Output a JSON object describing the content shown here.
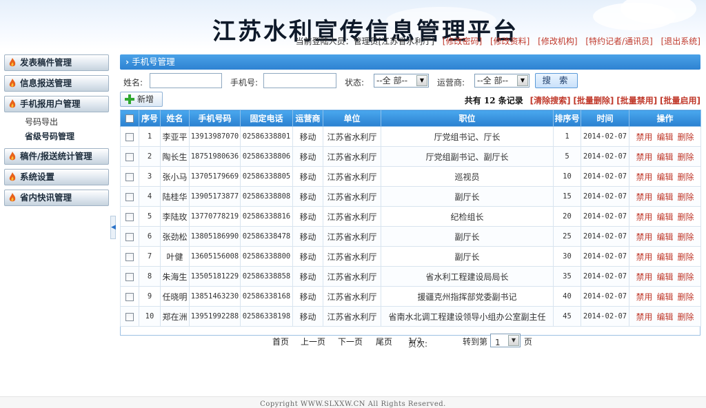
{
  "header": {
    "title": "江苏水利宣传信息管理平台",
    "current_user_label": "当前登陆人员：管理员[江苏省水利厅]",
    "links": [
      "[修改密码]",
      "[修改资料]",
      "[修改机构]",
      "[特约记者/通讯员]",
      "[退出系统]"
    ]
  },
  "sidebar": {
    "items": [
      {
        "label": "发表稿件管理"
      },
      {
        "label": "信息报送管理"
      },
      {
        "label": "手机报用户管理"
      },
      {
        "label": "稿件/报送统计管理"
      },
      {
        "label": "系统设置"
      },
      {
        "label": "省内快讯管理"
      }
    ],
    "sub_items": [
      "号码导出",
      "省级号码管理"
    ]
  },
  "panel": {
    "title": "手机号管理"
  },
  "search": {
    "name_label": "姓名:",
    "phone_label": "手机号:",
    "status_label": "状态:",
    "status_value": "--全 部--",
    "carrier_label": "运营商:",
    "carrier_value": "--全 部--",
    "search_button": "搜 索"
  },
  "actions": {
    "add_button": "新增",
    "total_label": "共有 12 条记录",
    "clear_search": "[清除搜索]",
    "bulk_delete": "[批量删除]",
    "bulk_disable": "[批量禁用]",
    "bulk_enable": "[批量启用]"
  },
  "table": {
    "headers": [
      "序号",
      "姓名",
      "手机号码",
      "固定电话",
      "运营商",
      "单位",
      "职位",
      "排序号",
      "时间",
      "操作"
    ],
    "op_labels": [
      "禁用",
      "编辑",
      "删除"
    ],
    "rows": [
      {
        "no": "1",
        "name": "李亚平",
        "mobile": "13913987070",
        "phone": "02586338801",
        "carrier": "移动",
        "unit": "江苏省水利厅",
        "position": "厅党组书记、厅长",
        "sort": "1",
        "time": "2014-02-07"
      },
      {
        "no": "2",
        "name": "陶长生",
        "mobile": "18751980636",
        "phone": "02586338806",
        "carrier": "移动",
        "unit": "江苏省水利厅",
        "position": "厅党组副书记、副厅长",
        "sort": "5",
        "time": "2014-02-07"
      },
      {
        "no": "3",
        "name": "张小马",
        "mobile": "13705179669",
        "phone": "02586338805",
        "carrier": "移动",
        "unit": "江苏省水利厅",
        "position": "巡视员",
        "sort": "10",
        "time": "2014-02-07"
      },
      {
        "no": "4",
        "name": "陆桂华",
        "mobile": "13905173877",
        "phone": "02586338808",
        "carrier": "移动",
        "unit": "江苏省水利厅",
        "position": "副厅长",
        "sort": "15",
        "time": "2014-02-07"
      },
      {
        "no": "5",
        "name": "李陆玫",
        "mobile": "13770778219",
        "phone": "02586338816",
        "carrier": "移动",
        "unit": "江苏省水利厅",
        "position": "纪检组长",
        "sort": "20",
        "time": "2014-02-07"
      },
      {
        "no": "6",
        "name": "张劲松",
        "mobile": "13805186990",
        "phone": "02586338478",
        "carrier": "移动",
        "unit": "江苏省水利厅",
        "position": "副厅长",
        "sort": "25",
        "time": "2014-02-07"
      },
      {
        "no": "7",
        "name": "叶健",
        "mobile": "13605156008",
        "phone": "02586338800",
        "carrier": "移动",
        "unit": "江苏省水利厅",
        "position": "副厅长",
        "sort": "30",
        "time": "2014-02-07"
      },
      {
        "no": "8",
        "name": "朱海生",
        "mobile": "13505181229",
        "phone": "02586338858",
        "carrier": "移动",
        "unit": "江苏省水利厅",
        "position": "省水利工程建设局局长",
        "sort": "35",
        "time": "2014-02-07"
      },
      {
        "no": "9",
        "name": "任晓明",
        "mobile": "13851463230",
        "phone": "02586338168",
        "carrier": "移动",
        "unit": "江苏省水利厅",
        "position": "援疆克州指挥部党委副书记",
        "sort": "40",
        "time": "2014-02-07"
      },
      {
        "no": "10",
        "name": "郑在洲",
        "mobile": "13951992288",
        "phone": "02586338198",
        "carrier": "移动",
        "unit": "江苏省水利厅",
        "position": "省南水北调工程建设领导小组办公室副主任",
        "sort": "45",
        "time": "2014-02-07"
      }
    ]
  },
  "pager": {
    "first": "首页",
    "prev": "上一页",
    "next": "下一页",
    "last": "尾页",
    "page_label": "页次:",
    "page_value": "1/2",
    "goto_label": "转到第",
    "goto_value": "1",
    "page_suffix": "页"
  },
  "footer": {
    "copyright": "Copyright WWW.SLXXW.CN All Rights Reserved."
  },
  "colors": {
    "accent": "#2e82d2",
    "link_red": "#c0392b"
  }
}
